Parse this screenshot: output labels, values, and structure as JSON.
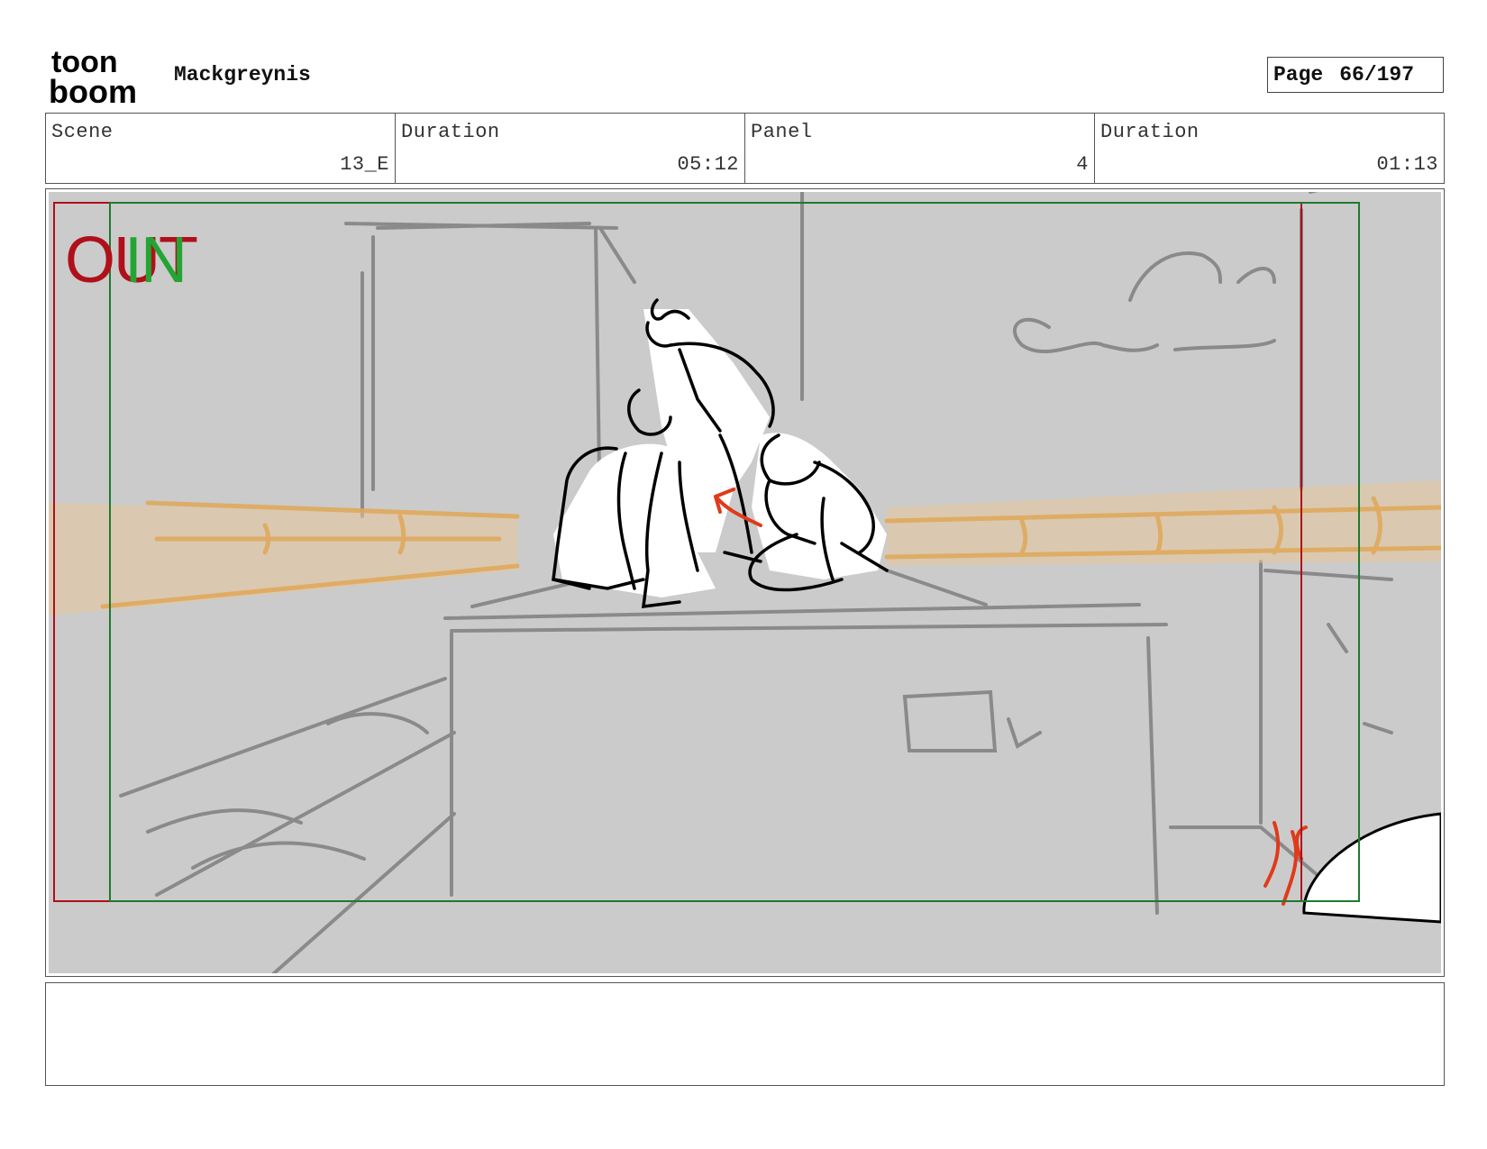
{
  "header": {
    "logo_text_top": "toon",
    "logo_text_bottom": "boom",
    "project_name": "Mackgreynis",
    "page_label": "Page",
    "page_value": "66/197"
  },
  "info": {
    "scene_label": "Scene",
    "scene_value": "13_E",
    "scene_duration_label": "Duration",
    "scene_duration_value": "05:12",
    "panel_label": "Panel",
    "panel_value": "4",
    "panel_duration_label": "Duration",
    "panel_duration_value": "01:13"
  },
  "panel": {
    "out_label": "OUT",
    "in_label": "IN",
    "colors": {
      "background": "#cbcbcb",
      "out_frame": "#b0101a",
      "in_frame": "#1e7a2e",
      "in_text": "#22a532",
      "sketch_line": "#8a8a8a",
      "pipe": "#e8b97a",
      "figure_line": "#000000",
      "accent_arrow": "#e03a1a"
    }
  },
  "notes": {
    "text": ""
  }
}
